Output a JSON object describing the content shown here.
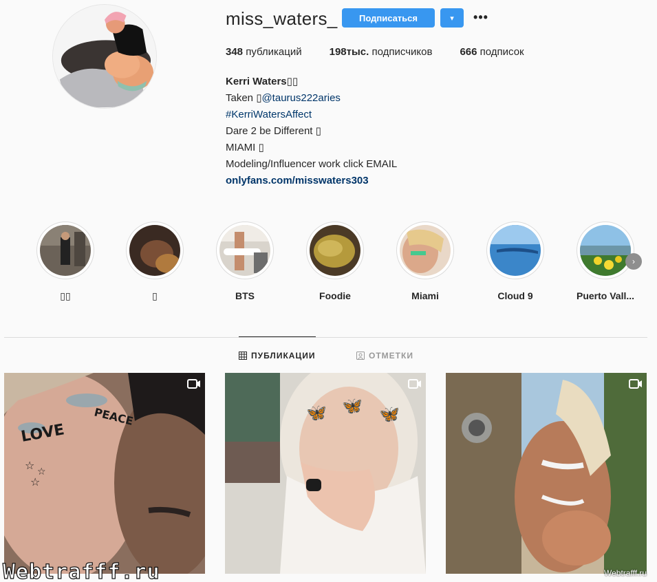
{
  "profile": {
    "username": "miss_waters_",
    "follow_label": "Подписаться",
    "dropdown_label": "▾",
    "more_label": "•••"
  },
  "stats": {
    "posts_count": "348",
    "posts_label": " публикаций",
    "followers_count": "198тыс.",
    "followers_label": " подписчиков",
    "following_count": "666",
    "following_label": " подписок"
  },
  "bio": {
    "name": "Kerri Waters▯▯",
    "line1_prefix": "Taken ▯",
    "line1_link": "@taurus222aries",
    "line2": "#KerriWatersAffect",
    "line3": "Dare 2 be Different ▯",
    "line4": "MIAMI ▯",
    "line5": "Modeling/Influencer work click EMAIL",
    "website": "onlyfans.com/misswaters303"
  },
  "highlights": [
    {
      "label": "▯▯"
    },
    {
      "label": "▯"
    },
    {
      "label": "BTS"
    },
    {
      "label": "Foodie"
    },
    {
      "label": "Miami"
    },
    {
      "label": "Cloud 9"
    },
    {
      "label": "Puerto Vall..."
    }
  ],
  "highlight_next": "›",
  "tabs": {
    "posts": "ПУБЛИКАЦИИ",
    "tagged": "ОТМЕТКИ"
  },
  "posts": [
    {
      "type": "video",
      "stickers": [
        "LOVE",
        "PEACE"
      ]
    },
    {
      "type": "video"
    },
    {
      "type": "video"
    }
  ],
  "watermarks": {
    "left": "Webtrafff.ru",
    "right": "Webtrafff.ru"
  },
  "colors": {
    "accent": "#3897f0",
    "link": "#003569"
  }
}
